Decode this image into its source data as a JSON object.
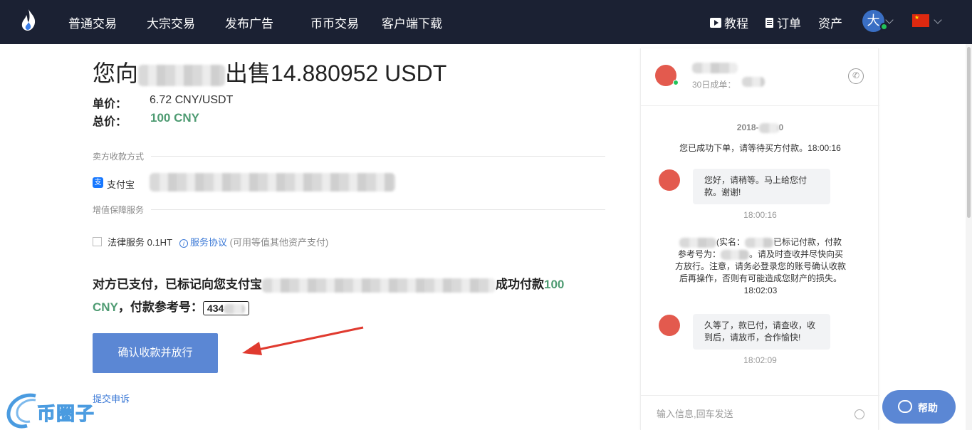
{
  "nav": {
    "items": [
      "普通交易",
      "大宗交易",
      "发布广告",
      "币币交易",
      "客户端下载"
    ],
    "tutorial": "教程",
    "orders": "订单",
    "assets": "资产",
    "avatar_letter": "大"
  },
  "order": {
    "title_prefix": "您向",
    "title_suffix": "出售14.880952 USDT",
    "unit_price_label": "单价：",
    "unit_price": "6.72 CNY/USDT",
    "total_label": "总价：",
    "total": "100 CNY",
    "seller_payment_head": "卖方收款方式",
    "alipay_label": "支付宝",
    "value_added_head": "增值保障服务",
    "legal_service": "法律服务 0.1HT",
    "service_agreement": "服务协议",
    "service_note": "(可用等值其他资产支付)",
    "paid_text_1": "对方已支付，已标记向您支付宝",
    "paid_text_2": "成功付款",
    "paid_amount_a": "100",
    "paid_amount_b": "CNY",
    "ref_label": "，付款参考号：",
    "ref_value": "434",
    "confirm_button": "确认收款并放行",
    "appeal_link": "提交申诉"
  },
  "chat": {
    "deals_label": "30日成单：",
    "date": "2018-",
    "date_end": "0",
    "sys_order": "您已成功下单，请等待买方付款。18:00:16",
    "msg1": "您好，请稍等。马上给您付款。谢谢!",
    "msg1_time": "18:00:16",
    "sys_paid_1": "(实名：",
    "sys_paid_2": "已标记付款，付",
    "sys_paid_3": "款参考号为：",
    "sys_paid_4": "。请及时查收并尽快向买方放行。注意，请务必登录您的账号确认收款后再操作，否则有可能造成您财产的损失。18:02:03",
    "msg2": "久等了，款已付，请查收，收到后，请放币，合作愉快!",
    "msg2_time": "18:02:09",
    "input_placeholder": "输入信息,回车发送"
  },
  "help": {
    "label": "帮助"
  },
  "watermark": {
    "text": "币圈子"
  },
  "colors": {
    "nav_bg": "#1b2133",
    "accent_blue": "#5b87d4",
    "green": "#4e9b72",
    "avatar_red": "#e35a4e"
  },
  "icons": [
    "flame-logo-icon",
    "play-icon",
    "document-icon",
    "chevron-down-icon",
    "china-flag-icon",
    "alipay-icon",
    "info-icon",
    "phone-icon",
    "paperclip-icon",
    "chat-bubble-icon"
  ]
}
